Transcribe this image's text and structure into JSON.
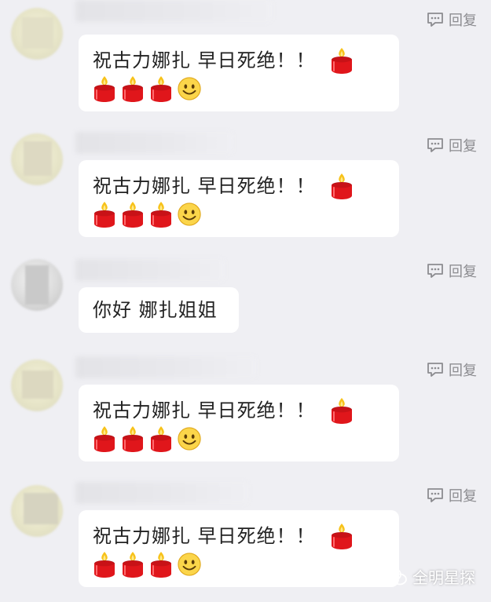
{
  "reply_label": "回复",
  "wish_text_line1": "祝古力娜扎  早日死绝！！",
  "greeting_text": "你好 娜扎姐姐",
  "watermark": "全明星探",
  "icons": {
    "reply": "comment-bubble-icon",
    "candle": "candle-emoji-icon",
    "smile": "smile-emoji-icon",
    "watermark": "wechat-logo-icon"
  },
  "colors": {
    "background": "#efeff3",
    "bubble": "#ffffff",
    "reply_text": "#8c8c90",
    "candle_red": "#e0161b"
  }
}
